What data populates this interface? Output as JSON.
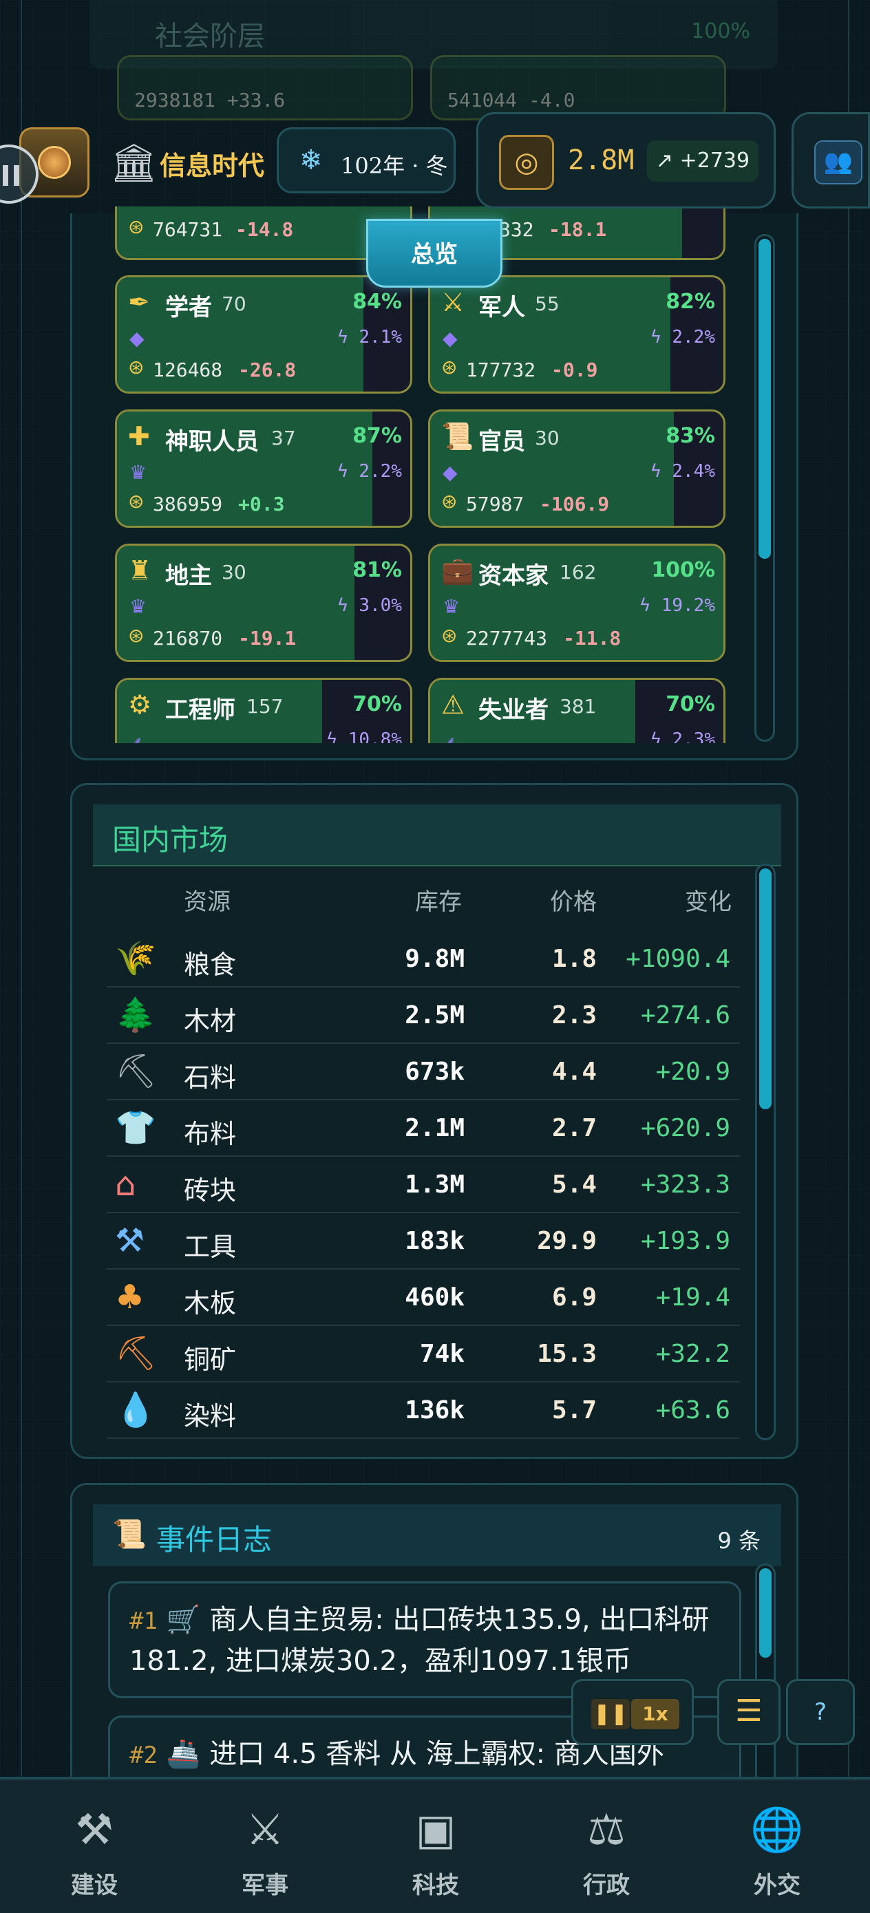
{
  "strata_header": {
    "title": "社会阶层",
    "percent": "100%",
    "ghost_values": [
      "2938181 +33.6",
      "541044 -4.0"
    ]
  },
  "topbar": {
    "era_title": "信息时代",
    "season": "102年 · 冬",
    "money": "2.8M",
    "money_delta": "+2739"
  },
  "overview_tab": "总览",
  "strata_top_row": [
    {
      "wealth": "764731",
      "change": "-14.8"
    },
    {
      "wealth": "332",
      "change": "-18.1"
    }
  ],
  "strata": [
    {
      "name": "学者",
      "pop": "70",
      "pct": "84%",
      "fill": 0.84,
      "tax": "2.1%",
      "wealth": "126468",
      "change": "-26.8",
      "icon": "feather-icon",
      "glyph": "✒",
      "sub": "gem-icon"
    },
    {
      "name": "军人",
      "pop": "55",
      "pct": "82%",
      "fill": 0.82,
      "tax": "2.2%",
      "wealth": "177732",
      "change": "-0.9",
      "icon": "swords-icon",
      "glyph": "⚔",
      "sub": "gem-icon"
    },
    {
      "name": "神职人员",
      "pop": "37",
      "pct": "87%",
      "fill": 0.87,
      "tax": "2.2%",
      "wealth": "386959",
      "change": "+0.3",
      "icon": "cross-icon",
      "glyph": "✚",
      "sub": "crown-icon"
    },
    {
      "name": "官员",
      "pop": "30",
      "pct": "83%",
      "fill": 0.83,
      "tax": "2.4%",
      "wealth": "57987",
      "change": "-106.9",
      "icon": "scroll-icon",
      "glyph": "📜",
      "sub": "gem-icon"
    },
    {
      "name": "地主",
      "pop": "30",
      "pct": "81%",
      "fill": 0.81,
      "tax": "3.0%",
      "wealth": "216870",
      "change": "-19.1",
      "icon": "castle-icon",
      "glyph": "♜",
      "sub": "crown-icon"
    },
    {
      "name": "资本家",
      "pop": "162",
      "pct": "100%",
      "fill": 1.0,
      "tax": "19.2%",
      "wealth": "2277743",
      "change": "-11.8",
      "icon": "briefcase-icon",
      "glyph": "💼",
      "sub": "crown-icon"
    },
    {
      "name": "工程师",
      "pop": "157",
      "pct": "70%",
      "fill": 0.7,
      "tax": "10.8%",
      "wealth": "",
      "change": "",
      "icon": "gear-icon",
      "glyph": "⚙",
      "sub": "wheat-icon"
    },
    {
      "name": "失业者",
      "pop": "381",
      "pct": "70%",
      "fill": 0.7,
      "tax": "2.3%",
      "wealth": "",
      "change": "",
      "icon": "warning-icon",
      "glyph": "⚠",
      "sub": "wheat-icon"
    }
  ],
  "market": {
    "title": "国内市场",
    "headers": {
      "resource": "资源",
      "stock": "库存",
      "price": "价格",
      "change": "变化"
    },
    "rows": [
      {
        "name": "粮食",
        "stock": "9.8M",
        "price": "1.8",
        "change": "+1090.4",
        "icon": "wheat-icon",
        "glyph": "🌾",
        "color": "#f2c94c"
      },
      {
        "name": "木材",
        "stock": "2.5M",
        "price": "2.3",
        "change": "+274.6",
        "icon": "tree-icon",
        "glyph": "🌲",
        "color": "#3fd396"
      },
      {
        "name": "石料",
        "stock": "673k",
        "price": "4.4",
        "change": "+20.9",
        "icon": "pickaxe-icon",
        "glyph": "⛏",
        "color": "#a7b0b5"
      },
      {
        "name": "布料",
        "stock": "2.1M",
        "price": "2.7",
        "change": "+620.9",
        "icon": "shirt-icon",
        "glyph": "👕",
        "color": "#9aa2ff"
      },
      {
        "name": "砖块",
        "stock": "1.3M",
        "price": "5.4",
        "change": "+323.3",
        "icon": "house-icon",
        "glyph": "⌂",
        "color": "#f27b7b"
      },
      {
        "name": "工具",
        "stock": "183k",
        "price": "29.9",
        "change": "+193.9",
        "icon": "anvil-icon",
        "glyph": "⚒",
        "color": "#6fb8ff"
      },
      {
        "name": "木板",
        "stock": "460k",
        "price": "6.9",
        "change": "+19.4",
        "icon": "tree-round-icon",
        "glyph": "♣",
        "color": "#f2a03c"
      },
      {
        "name": "铜矿",
        "stock": "74k",
        "price": "15.3",
        "change": "+32.2",
        "icon": "pickaxe-copper-icon",
        "glyph": "⛏",
        "color": "#f28a3c"
      },
      {
        "name": "染料",
        "stock": "136k",
        "price": "5.7",
        "change": "+63.6",
        "icon": "droplet-icon",
        "glyph": "💧",
        "color": "#ec4f9a"
      }
    ]
  },
  "event_log": {
    "title": "事件日志",
    "count": "9 条",
    "entries": [
      {
        "num": "#1",
        "emoji": "🛒",
        "text": "商人自主贸易: 出口砖块135.9, 出口科研181.2, 进口煤炭30.2，盈利1097.1银币"
      },
      {
        "num": "#2",
        "emoji": "🚢",
        "text": "进口 4.5 香料 从 海上霸权: 商人国外"
      }
    ]
  },
  "controls": {
    "speed": "1x"
  },
  "bottom_nav": [
    {
      "label": "建设",
      "icon": "hammer-icon",
      "glyph": "⚒"
    },
    {
      "label": "军事",
      "icon": "swords-icon",
      "glyph": "⚔"
    },
    {
      "label": "科技",
      "icon": "chip-icon",
      "glyph": "▣"
    },
    {
      "label": "行政",
      "icon": "gavel-icon",
      "glyph": "⚖"
    },
    {
      "label": "外交",
      "icon": "globe-icon",
      "glyph": "🌐"
    }
  ]
}
